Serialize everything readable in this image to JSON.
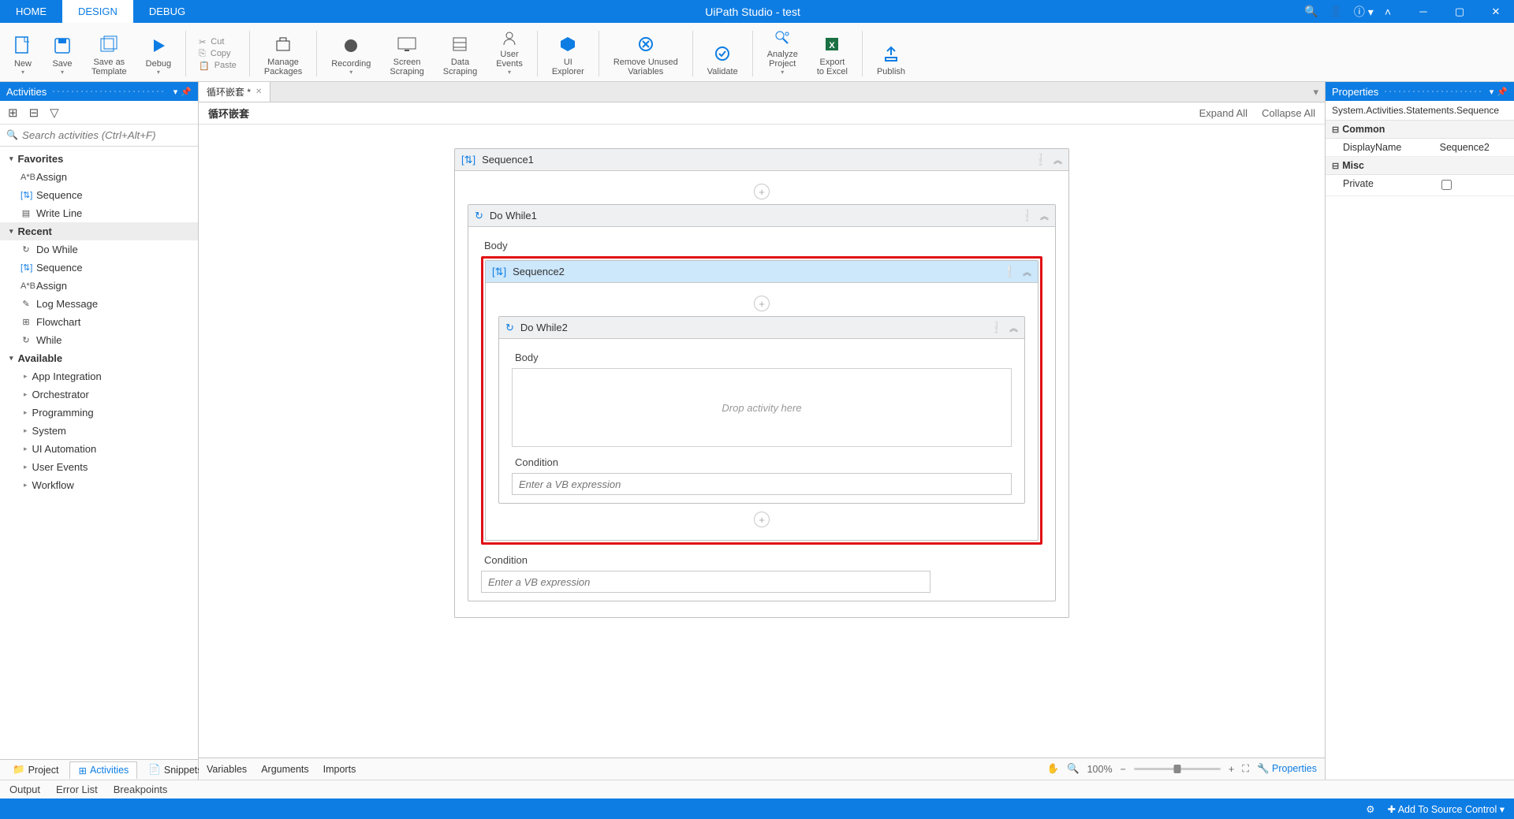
{
  "title": "UiPath Studio - test",
  "tabs": {
    "home": "HOME",
    "design": "DESIGN",
    "debug": "DEBUG"
  },
  "ribbon": {
    "new": "New",
    "save": "Save",
    "save_tpl": "Save as\nTemplate",
    "debug": "Debug",
    "cut": "Cut",
    "copy": "Copy",
    "paste": "Paste",
    "packages": "Manage\nPackages",
    "recording": "Recording",
    "screen": "Screen\nScraping",
    "data": "Data\nScraping",
    "user_events": "User\nEvents",
    "ui_explorer": "UI\nExplorer",
    "remove_unused": "Remove Unused\nVariables",
    "validate": "Validate",
    "analyze": "Analyze\nProject",
    "export": "Export\nto Excel",
    "publish": "Publish"
  },
  "activities": {
    "title": "Activities",
    "search_placeholder": "Search activities (Ctrl+Alt+F)",
    "groups": {
      "favorites": "Favorites",
      "recent": "Recent",
      "available": "Available"
    },
    "favorites": [
      "Assign",
      "Sequence",
      "Write Line"
    ],
    "recent": [
      "Do While",
      "Sequence",
      "Assign",
      "Log Message",
      "Flowchart",
      "While"
    ],
    "available": [
      "App Integration",
      "Orchestrator",
      "Programming",
      "System",
      "UI Automation",
      "User Events",
      "Workflow"
    ]
  },
  "footer_tabs": {
    "project": "Project",
    "activities": "Activities",
    "snippets": "Snippets"
  },
  "doc_tab": "循环嵌套 *",
  "breadcrumb": "循环嵌套",
  "expand_all": "Expand All",
  "collapse_all": "Collapse All",
  "workflow": {
    "seq1": "Sequence1",
    "dowhile1": "Do While1",
    "body": "Body",
    "seq2": "Sequence2",
    "dowhile2": "Do While2",
    "drop_hint": "Drop activity here",
    "condition": "Condition",
    "expr_placeholder": "Enter a VB expression"
  },
  "bottom_strip": {
    "variables": "Variables",
    "arguments": "Arguments",
    "imports": "Imports",
    "zoom": "100%",
    "properties_link": "Properties"
  },
  "properties": {
    "title": "Properties",
    "type": "System.Activities.Statements.Sequence",
    "common": "Common",
    "display_name_k": "DisplayName",
    "display_name_v": "Sequence2",
    "misc": "Misc",
    "private": "Private"
  },
  "output_row": {
    "output": "Output",
    "error": "Error List",
    "breakpoints": "Breakpoints"
  },
  "statusbar": {
    "source_control": "Add To Source Control"
  }
}
